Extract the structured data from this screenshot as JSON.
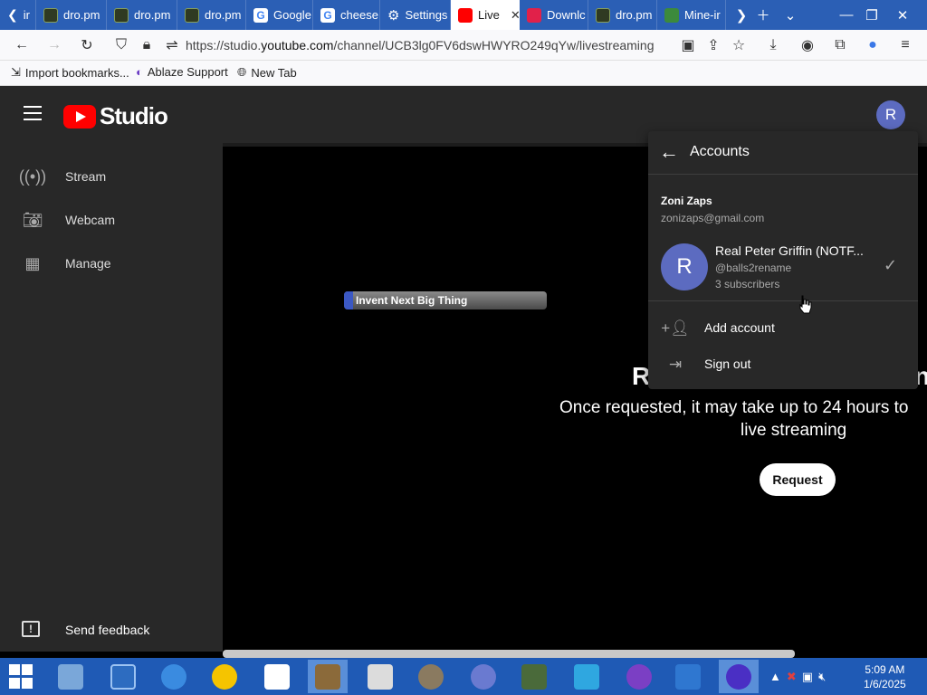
{
  "browser": {
    "tabs": [
      {
        "label": "ir",
        "icon": "chevron-left-icon"
      },
      {
        "label": "dro.pm",
        "icon": "dro-favicon"
      },
      {
        "label": "dro.pm",
        "icon": "dro-favicon"
      },
      {
        "label": "dro.pm",
        "icon": "dro-favicon"
      },
      {
        "label": "Google",
        "icon": "google-favicon"
      },
      {
        "label": "cheese",
        "icon": "google-favicon"
      },
      {
        "label": "Settings",
        "icon": "gear-icon"
      },
      {
        "label": "Live",
        "icon": "youtube-favicon",
        "active": true
      },
      {
        "label": "Downlc",
        "icon": "download-favicon"
      },
      {
        "label": "dro.pm",
        "icon": "dro-favicon"
      },
      {
        "label": "Mine-ir",
        "icon": "minecraft-favicon"
      }
    ],
    "url_prefix": "https://studio.",
    "url_host": "youtube.com",
    "url_path": "/channel/UCB3lg0FV6dswHWYRO249qYw/livestreaming",
    "bookmarks": [
      {
        "label": "Import bookmarks...",
        "icon": "import-icon"
      },
      {
        "label": "Ablaze Support",
        "icon": "ablaze-icon"
      },
      {
        "label": "New Tab",
        "icon": "globe-icon"
      }
    ]
  },
  "studio": {
    "logo_text": "Studio",
    "avatar_letter": "R",
    "sidebar": [
      {
        "label": "Stream",
        "icon": "broadcast-icon"
      },
      {
        "label": "Webcam",
        "icon": "camera-icon"
      },
      {
        "label": "Manage",
        "icon": "calendar-icon"
      }
    ],
    "send_feedback": "Send feedback",
    "invent_bar": "Invent Next Big Thing",
    "heading_start": "R",
    "heading_end": "n",
    "message_line1": "Once requested, it may take up to 24 hours to",
    "message_line2": "live streaming",
    "request_label": "Request"
  },
  "accounts": {
    "title": "Accounts",
    "user_name": "Zoni Zaps",
    "user_email": "zonizaps@gmail.com",
    "channel": {
      "avatar_letter": "R",
      "name": "Real Peter Griffin (NOTF...",
      "handle": "@balls2rename",
      "subscribers": "3 subscribers"
    },
    "add_account": "Add account",
    "sign_out": "Sign out"
  },
  "taskbar": {
    "clock_time": "5:09 AM",
    "clock_date": "1/6/2025"
  },
  "colors": {
    "accent_tab": "#2b5fb5",
    "studio_bg": "#282828",
    "avatar": "#5c6bc0",
    "youtube_red": "#ff0000"
  }
}
